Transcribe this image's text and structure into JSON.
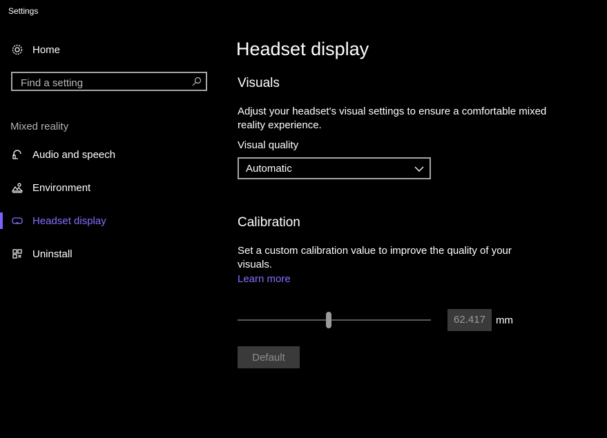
{
  "window": {
    "title": "Settings"
  },
  "sidebar": {
    "home_label": "Home",
    "search": {
      "placeholder": "Find a setting"
    },
    "section_label": "Mixed reality",
    "items": [
      {
        "label": "Audio and speech",
        "icon": "headset-icon"
      },
      {
        "label": "Environment",
        "icon": "environment-icon"
      },
      {
        "label": "Headset display",
        "icon": "headset-display-icon",
        "active": true
      },
      {
        "label": "Uninstall",
        "icon": "uninstall-icon"
      }
    ]
  },
  "main": {
    "title": "Headset display",
    "visuals": {
      "heading": "Visuals",
      "description": "Adjust your headset's visual settings to ensure a comfortable mixed reality experience.",
      "quality_label": "Visual quality",
      "quality_value": "Automatic"
    },
    "calibration": {
      "heading": "Calibration",
      "description": "Set a custom calibration value to improve the quality of your visuals.",
      "learn_more": "Learn more",
      "slider_fraction": 0.47,
      "value": "62.417",
      "unit": "mm",
      "default_button": "Default"
    }
  },
  "colors": {
    "accent": "#8a6cff",
    "background": "#000000"
  }
}
